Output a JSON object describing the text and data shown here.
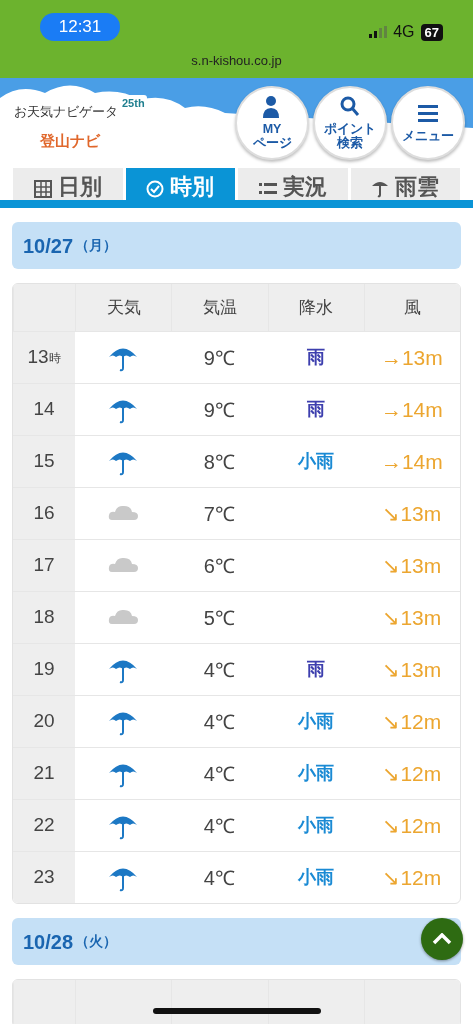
{
  "status_bar": {
    "time": "12:31",
    "network": "4G",
    "battery": "67"
  },
  "address_bar": {
    "url": "s.n-kishou.co.jp"
  },
  "header": {
    "logo_main": "お天気ナビゲータ",
    "logo_badge": "25th",
    "logo_sub": "登山ナビ",
    "buttons": [
      {
        "kind": "person",
        "lines": [
          "MY",
          "ページ"
        ]
      },
      {
        "kind": "search",
        "lines": [
          "ポイント",
          "検索"
        ]
      },
      {
        "kind": "menu",
        "lines": [
          "メニュー"
        ]
      }
    ]
  },
  "tabs": [
    {
      "kind": "calendar",
      "label": "日別",
      "selected": false
    },
    {
      "kind": "clock",
      "label": "時別",
      "selected": true
    },
    {
      "kind": "list",
      "label": "実況",
      "selected": false
    },
    {
      "kind": "umbrella",
      "label": "雨雲",
      "selected": false
    }
  ],
  "days": [
    {
      "date": "10/27",
      "weekday": "（月）",
      "columns": [
        "天気",
        "気温",
        "降水",
        "風"
      ],
      "rows": [
        {
          "hour": "13",
          "unit": "時",
          "kind": "rain",
          "temp": "9℃",
          "precip": {
            "text": "雨",
            "color": "#3d3fae"
          },
          "wind": "→13m"
        },
        {
          "hour": "14",
          "kind": "rain",
          "temp": "9℃",
          "precip": {
            "text": "雨",
            "color": "#3d3fae"
          },
          "wind": "→14m"
        },
        {
          "hour": "15",
          "kind": "rain",
          "temp": "8℃",
          "precip": {
            "text": "小雨",
            "color": "#1a8ad4"
          },
          "wind": "→14m"
        },
        {
          "hour": "16",
          "kind": "cloud",
          "temp": "7℃",
          "wind": "↘13m"
        },
        {
          "hour": "17",
          "kind": "cloud",
          "temp": "6℃",
          "wind": "↘13m"
        },
        {
          "hour": "18",
          "kind": "cloud",
          "temp": "5℃",
          "wind": "↘13m"
        },
        {
          "hour": "19",
          "kind": "rain",
          "temp": "4℃",
          "precip": {
            "text": "雨",
            "color": "#3d3fae"
          },
          "wind": "↘13m"
        },
        {
          "hour": "20",
          "kind": "rain",
          "temp": "4℃",
          "precip": {
            "text": "小雨",
            "color": "#1a8ad4"
          },
          "wind": "↘12m"
        },
        {
          "hour": "21",
          "kind": "rain",
          "temp": "4℃",
          "precip": {
            "text": "小雨",
            "color": "#1a8ad4"
          },
          "wind": "↘12m"
        },
        {
          "hour": "22",
          "kind": "rain",
          "temp": "4℃",
          "precip": {
            "text": "小雨",
            "color": "#1a8ad4"
          },
          "wind": "↘12m"
        },
        {
          "hour": "23",
          "kind": "rain",
          "temp": "4℃",
          "precip": {
            "text": "小雨",
            "color": "#1a8ad4"
          },
          "wind": "↘12m"
        }
      ]
    },
    {
      "date": "10/28",
      "weekday": "（火）"
    }
  ]
}
